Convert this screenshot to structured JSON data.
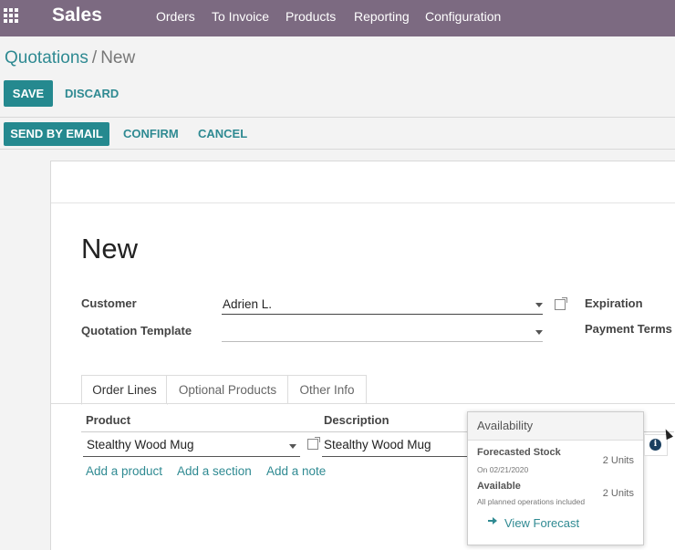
{
  "topbar": {
    "app_title": "Sales",
    "menu": [
      "Orders",
      "To Invoice",
      "Products",
      "Reporting",
      "Configuration"
    ]
  },
  "breadcrumb": {
    "parent": "Quotations",
    "separator": "/",
    "current": "New"
  },
  "control": {
    "save": "SAVE",
    "discard": "DISCARD"
  },
  "statusbar": {
    "send_email": "SEND BY EMAIL",
    "confirm": "CONFIRM",
    "cancel": "CANCEL"
  },
  "form": {
    "title": "New",
    "customer_label": "Customer",
    "customer_value": "Adrien L.",
    "template_label": "Quotation Template",
    "template_value": "",
    "expiration_label": "Expiration",
    "payment_terms_label": "Payment Terms"
  },
  "tabs": [
    "Order Lines",
    "Optional Products",
    "Other Info"
  ],
  "order_lines": {
    "columns": [
      "Product",
      "Description"
    ],
    "rows": [
      {
        "product": "Stealthy Wood Mug",
        "description": "Stealthy Wood Mug"
      }
    ],
    "add_product": "Add a product",
    "add_section": "Add a section",
    "add_note": "Add a note"
  },
  "availability": {
    "title": "Availability",
    "forecasted_label": "Forecasted Stock",
    "forecasted_date": "On 02/21/2020",
    "forecasted_value": "2 Units",
    "available_label": "Available",
    "available_note": "All planned operations included",
    "available_value": "2 Units",
    "view_forecast": "View Forecast"
  },
  "icons": {
    "apps": "apps-grid-icon",
    "external": "external-link-icon",
    "info": "info-icon",
    "dropdown": "caret-down-icon",
    "arrow": "arrow-right-icon"
  },
  "colors": {
    "topbar": "#7c6a81",
    "primary": "#25898f",
    "link": "#2f8a92"
  }
}
